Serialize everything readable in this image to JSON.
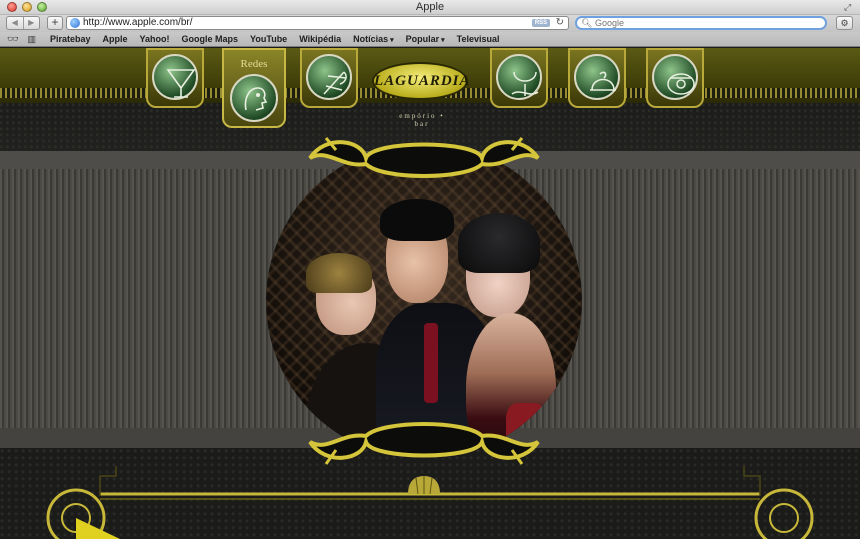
{
  "window": {
    "title": "Apple",
    "traffic_lights": [
      "close",
      "minimize",
      "zoom"
    ]
  },
  "toolbar": {
    "back_icon": "back-arrow-icon",
    "forward_icon": "forward-arrow-icon",
    "add_label": "+",
    "url": "http://www.apple.com/br/",
    "rss_label": "RSS",
    "search_placeholder": "Google"
  },
  "bookmarks": {
    "items": [
      {
        "label": "Piratebay",
        "menu": false
      },
      {
        "label": "Apple",
        "menu": false
      },
      {
        "label": "Yahoo!",
        "menu": false
      },
      {
        "label": "Google Maps",
        "menu": false
      },
      {
        "label": "YouTube",
        "menu": false
      },
      {
        "label": "Wikipédia",
        "menu": false
      },
      {
        "label": "Notícias",
        "menu": true
      },
      {
        "label": "Popular",
        "menu": true
      },
      {
        "label": "Televisual",
        "menu": false
      }
    ]
  },
  "site": {
    "redes_label": "Redes",
    "logo_text": "LAGUARDIA",
    "logo_sub": "empório • bar",
    "nav_icons": [
      "cocktail-glass-icon",
      "networks-profile-icon",
      "music-notes-icon",
      "logo",
      "wine-glass-icon",
      "food-dish-icon",
      "contact-phone-icon"
    ]
  },
  "colors": {
    "gold": "#c7b745",
    "olive": "#5b5a14",
    "leather": "#1c1c1a",
    "search_focus": "#6fa0e0"
  }
}
